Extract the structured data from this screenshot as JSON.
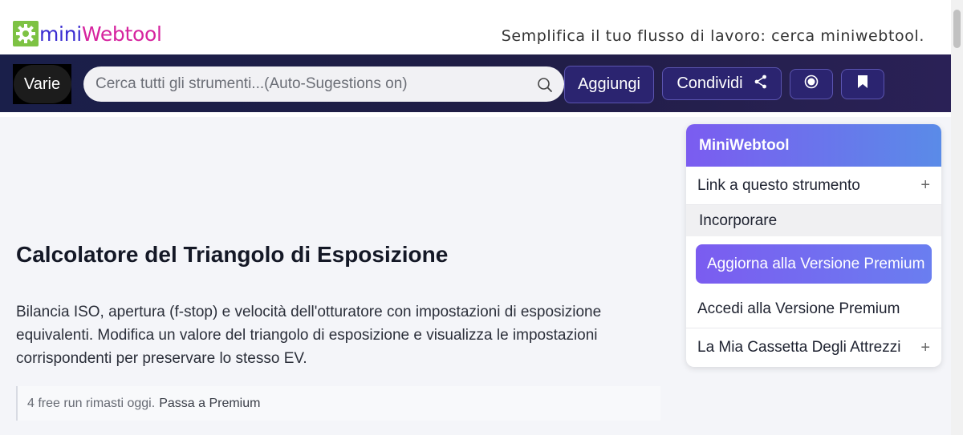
{
  "header": {
    "logo_mini": "mini",
    "logo_web": "Webtool",
    "tagline": "Semplifica il tuo flusso di lavoro: cerca miniwebtool."
  },
  "nav": {
    "varie_label": "Varie",
    "search_placeholder": "Cerca tutti gli strumenti...(Auto-Sugestions on)",
    "add_label": "Aggiungi",
    "share_label": "Condividi"
  },
  "main": {
    "title": "Calcolatore del Triangolo di Esposizione",
    "description": "Bilancia ISO, apertura (f-stop) e velocità dell'otturatore con impostazioni di esposizione equivalenti. Modifica un valore del triangolo di esposizione e visualizza le impostazioni corrispondenti per preservare lo stesso EV.",
    "free_runs_text": "4 free run rimasti oggi.",
    "free_runs_link": "Passa a Premium"
  },
  "panel": {
    "title": "MiniWebtool",
    "link_label": "Link a questo strumento",
    "embed_label": "Incorporare",
    "upgrade_label": "Aggiorna alla Versione Premium",
    "access_label": "Accedi alla Versione Premium",
    "toolbox_label": "La Mia Cassetta Degli Attrezzi",
    "plus": "+"
  },
  "colors": {
    "logo_green": "#7dc243",
    "logo_mini": "#3b2dd1",
    "logo_web": "#d6249f",
    "navbar": "#1a1f4a",
    "accent_purple": "#7b5cf0"
  }
}
